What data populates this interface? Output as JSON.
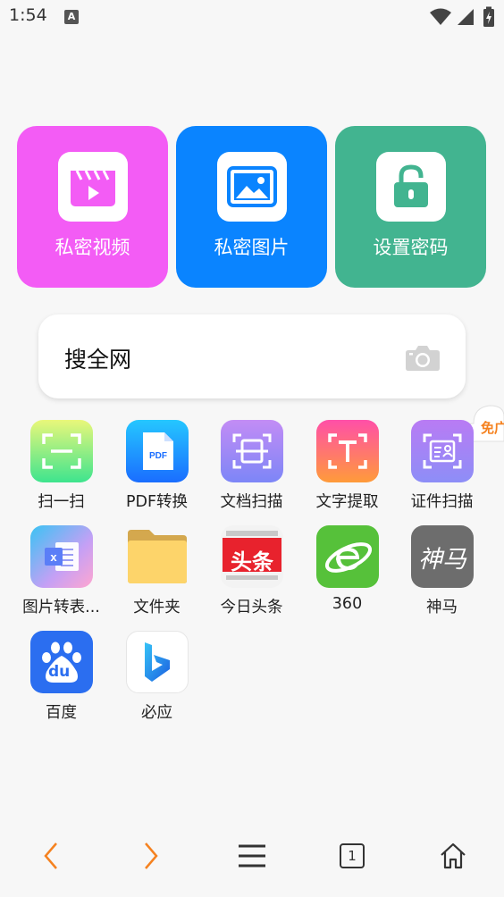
{
  "status_bar": {
    "time": "1:54",
    "notification_icon": "A"
  },
  "feature_cards": [
    {
      "label": "私密视频",
      "icon": "video-icon",
      "color": "#f35cf5"
    },
    {
      "label": "私密图片",
      "icon": "image-icon",
      "color": "#0a84ff"
    },
    {
      "label": "设置密码",
      "icon": "lock-icon",
      "color": "#42b490"
    }
  ],
  "search": {
    "placeholder": "搜全网",
    "icon": "camera-icon"
  },
  "apps": [
    {
      "label": "扫一扫",
      "icon": "scan-icon"
    },
    {
      "label": "PDF转换",
      "icon": "pdf-icon"
    },
    {
      "label": "文档扫描",
      "icon": "document-scan-icon"
    },
    {
      "label": "文字提取",
      "icon": "text-extract-icon"
    },
    {
      "label": "证件扫描",
      "icon": "id-scan-icon"
    },
    {
      "label": "图片转表...",
      "icon": "image-to-excel-icon"
    },
    {
      "label": "文件夹",
      "icon": "folder-icon"
    },
    {
      "label": "今日头条",
      "icon": "toutiao-icon",
      "icon_text": "头条"
    },
    {
      "label": "360",
      "icon": "360-browser-icon"
    },
    {
      "label": "神马",
      "icon": "shenma-icon",
      "icon_text": "神马"
    },
    {
      "label": "百度",
      "icon": "baidu-icon",
      "icon_text": "du"
    },
    {
      "label": "必应",
      "icon": "bing-icon"
    }
  ],
  "floating_badge": {
    "text": "免广",
    "icon": "cloud-icon"
  },
  "bottom_nav": {
    "tab_count": "1",
    "items": [
      "back-icon",
      "forward-icon",
      "menu-icon",
      "tabs-icon",
      "home-icon"
    ]
  },
  "colors": {
    "accent_orange": "#f58220",
    "background": "#f7f7f7"
  }
}
